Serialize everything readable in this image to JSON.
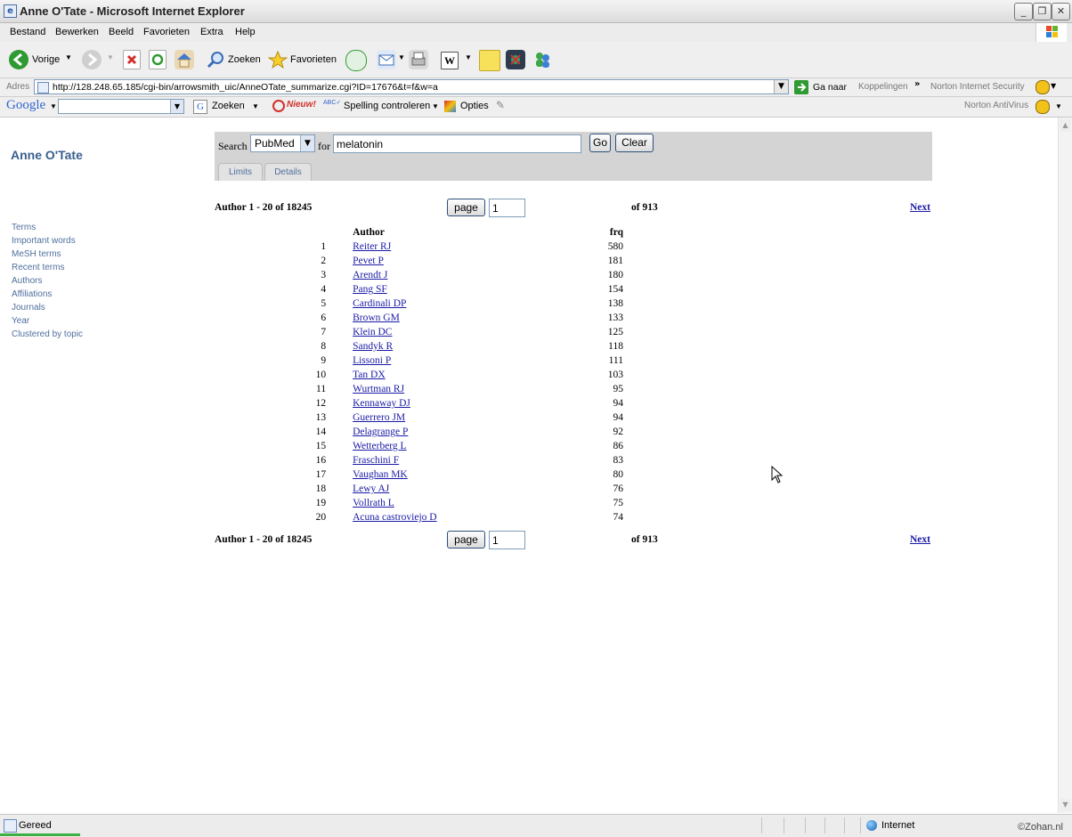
{
  "window": {
    "title": "Anne O'Tate - Microsoft Internet Explorer"
  },
  "menu": [
    "Bestand",
    "Bewerken",
    "Beeld",
    "Favorieten",
    "Extra",
    "Help"
  ],
  "toolbar": {
    "back_label": "Vorige",
    "search_label": "Zoeken",
    "favorites_label": "Favorieten"
  },
  "address": {
    "label": "Adres",
    "url": "http://128.248.65.185/cgi-bin/arrowsmith_uic/AnneOTate_summarize.cgi?ID=17676&t=f&w=a",
    "go_label": "Ga naar",
    "links_label": "Koppelingen",
    "norton_label": "Norton Internet Security"
  },
  "google_bar": {
    "logo": "Google",
    "search_label": "Zoeken",
    "new_label": "Nieuw!",
    "spell_label": "Spelling controleren",
    "options_label": "Opties",
    "antivirus_label": "Norton AntiVirus"
  },
  "site": {
    "title": "Anne O'Tate",
    "nav": [
      "Terms",
      "Important words",
      "MeSH terms",
      "Recent terms",
      "Authors",
      "Affiliations",
      "Journals",
      "Year",
      "Clustered by topic"
    ]
  },
  "search": {
    "search_label": "Search",
    "database": "PubMed",
    "for_label": "for",
    "query": "melatonin",
    "go_label": "Go",
    "clear_label": "Clear",
    "tabs": [
      "Limits",
      "Details"
    ]
  },
  "pagination": {
    "range_label": "Author 1 - 20 of 18245",
    "page_button": "page",
    "page_value": "1",
    "of_label": "of 913",
    "next_label": "Next"
  },
  "table": {
    "headers": {
      "author": "Author",
      "frq": "frq"
    },
    "rows": [
      {
        "n": "1",
        "author": "Reiter RJ",
        "frq": "580"
      },
      {
        "n": "2",
        "author": "Pevet P",
        "frq": "181"
      },
      {
        "n": "3",
        "author": "Arendt J",
        "frq": "180"
      },
      {
        "n": "4",
        "author": "Pang SF",
        "frq": "154"
      },
      {
        "n": "5",
        "author": "Cardinali DP",
        "frq": "138"
      },
      {
        "n": "6",
        "author": "Brown GM",
        "frq": "133"
      },
      {
        "n": "7",
        "author": "Klein DC",
        "frq": "125"
      },
      {
        "n": "8",
        "author": "Sandyk R",
        "frq": "118"
      },
      {
        "n": "9",
        "author": "Lissoni P",
        "frq": "111"
      },
      {
        "n": "10",
        "author": "Tan DX",
        "frq": "103"
      },
      {
        "n": "11",
        "author": "Wurtman RJ",
        "frq": "95"
      },
      {
        "n": "12",
        "author": "Kennaway DJ",
        "frq": "94"
      },
      {
        "n": "13",
        "author": "Guerrero JM",
        "frq": "94"
      },
      {
        "n": "14",
        "author": "Delagrange P",
        "frq": "92"
      },
      {
        "n": "15",
        "author": "Wetterberg L",
        "frq": "86"
      },
      {
        "n": "16",
        "author": "Fraschini F",
        "frq": "83"
      },
      {
        "n": "17",
        "author": "Vaughan MK",
        "frq": "80"
      },
      {
        "n": "18",
        "author": "Lewy AJ",
        "frq": "76"
      },
      {
        "n": "19",
        "author": "Vollrath L",
        "frq": "75"
      },
      {
        "n": "20",
        "author": "Acuna castroviejo D",
        "frq": "74"
      }
    ]
  },
  "status": {
    "text": "Gereed",
    "zone": "Internet",
    "watermark": "©Zohan.nl"
  },
  "colors": {
    "link": "#1a1aa6",
    "nav": "#4f6f9e",
    "title": "#3a5f8e",
    "panel": "#d4d4d4"
  }
}
